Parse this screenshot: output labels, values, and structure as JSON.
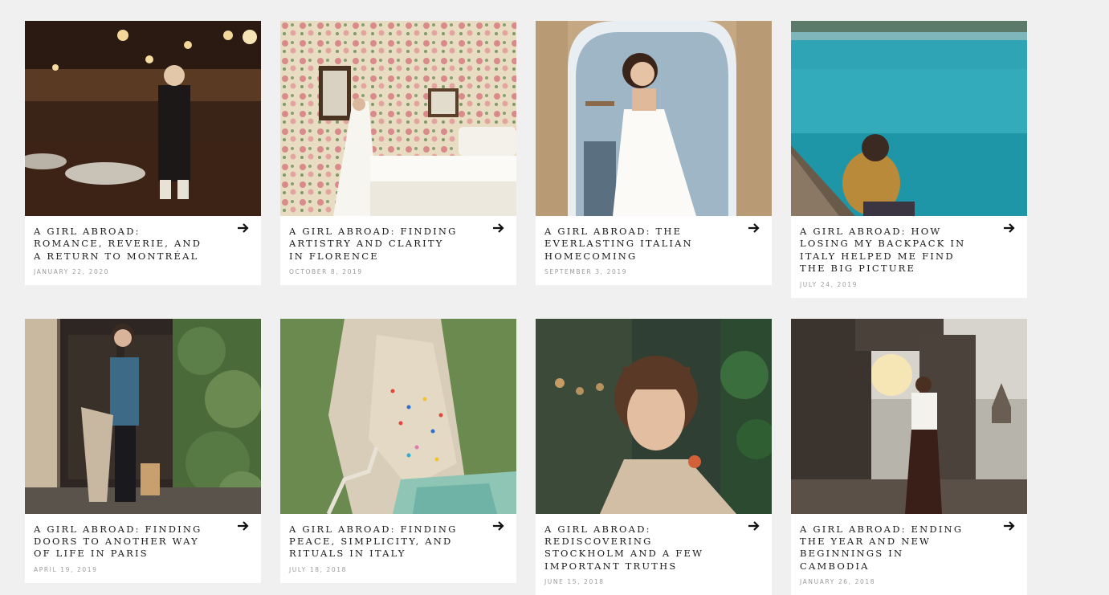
{
  "posts": [
    {
      "title": "A GIRL ABROAD:\nROMANCE, REVERIE, AND\nA RETURN TO MONTRÉAL",
      "date": "JANUARY 22, 2020"
    },
    {
      "title": "A GIRL ABROAD: FINDING\nARTISTRY AND CLARITY\nIN FLORENCE",
      "date": "OCTOBER 8, 2019"
    },
    {
      "title": "A GIRL ABROAD: THE\nEVERLASTING ITALIAN\nHOMECOMING",
      "date": "SEPTEMBER 3, 2019"
    },
    {
      "title": "A GIRL ABROAD: HOW\nLOSING MY BACKPACK IN\nITALY HELPED ME FIND\nTHE BIG PICTURE",
      "date": "JULY 24, 2019"
    },
    {
      "title": "A GIRL ABROAD: FINDING\nDOORS TO ANOTHER WAY\nOF LIFE IN PARIS",
      "date": "APRIL 19, 2019"
    },
    {
      "title": "A GIRL ABROAD: FINDING\nPEACE, SIMPLICITY, AND\nRITUALS IN ITALY",
      "date": "JULY 18, 2018"
    },
    {
      "title": "A GIRL ABROAD:\nREDISCOVERING\nSTOCKHOLM AND A FEW\nIMPORTANT TRUTHS",
      "date": "JUNE 15, 2018"
    },
    {
      "title": "A GIRL ABROAD: ENDING\nTHE YEAR AND NEW\nBEGINNINGS IN\nCAMBODIA",
      "date": "JANUARY 26, 2018"
    }
  ],
  "icons": {
    "arrow": "arrow-right-icon"
  },
  "colors": {
    "page_background": "#f0f0f0",
    "card_background": "#ffffff",
    "title_text": "#1a1a1a",
    "date_text": "#9a9a9a"
  }
}
